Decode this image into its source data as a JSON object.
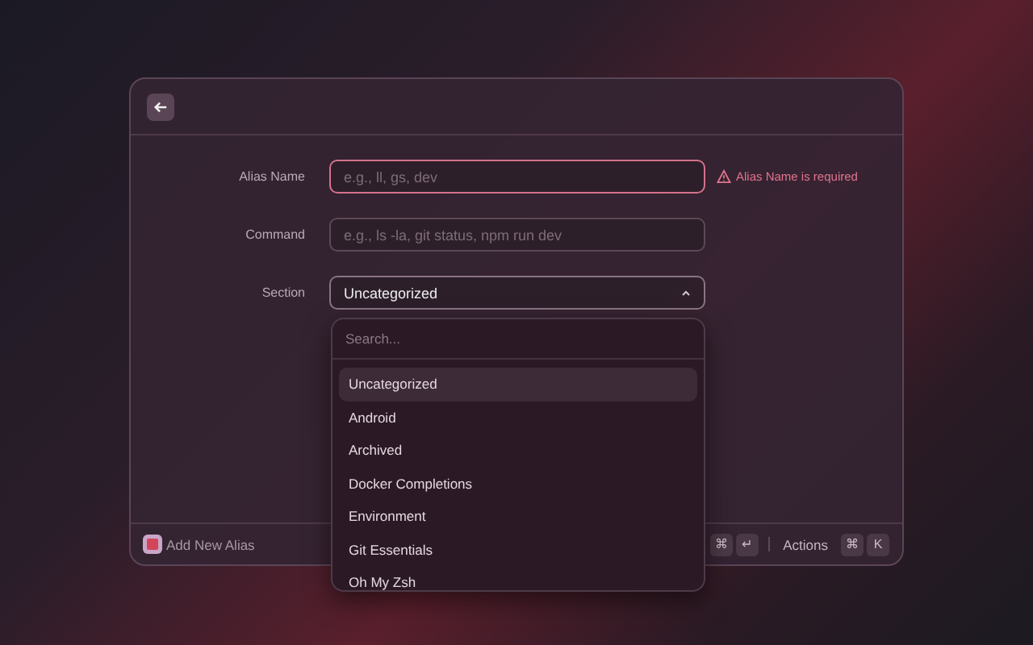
{
  "form": {
    "fields": [
      {
        "kind": "text",
        "label": "Alias Name",
        "placeholder": "e.g., ll, gs, dev",
        "error": "Alias Name is required"
      },
      {
        "kind": "text",
        "label": "Command",
        "placeholder": "e.g., ls -la, git status, npm run dev"
      },
      {
        "kind": "select",
        "label": "Section",
        "value": "Uncategorized",
        "expanded": true
      }
    ]
  },
  "dropdown": {
    "search_placeholder": "Search...",
    "items": [
      {
        "label": "Uncategorized",
        "selected": true
      },
      {
        "label": "Android",
        "selected": false
      },
      {
        "label": "Archived",
        "selected": false
      },
      {
        "label": "Docker Completions",
        "selected": false
      },
      {
        "label": "Environment",
        "selected": false
      },
      {
        "label": "Git Essentials",
        "selected": false
      },
      {
        "label": "Oh My Zsh",
        "selected": false
      }
    ]
  },
  "footer": {
    "title": "Add New Alias",
    "submit_keys": [
      "⌘",
      "↵"
    ],
    "actions_label": "Actions",
    "actions_keys": [
      "⌘",
      "K"
    ]
  }
}
